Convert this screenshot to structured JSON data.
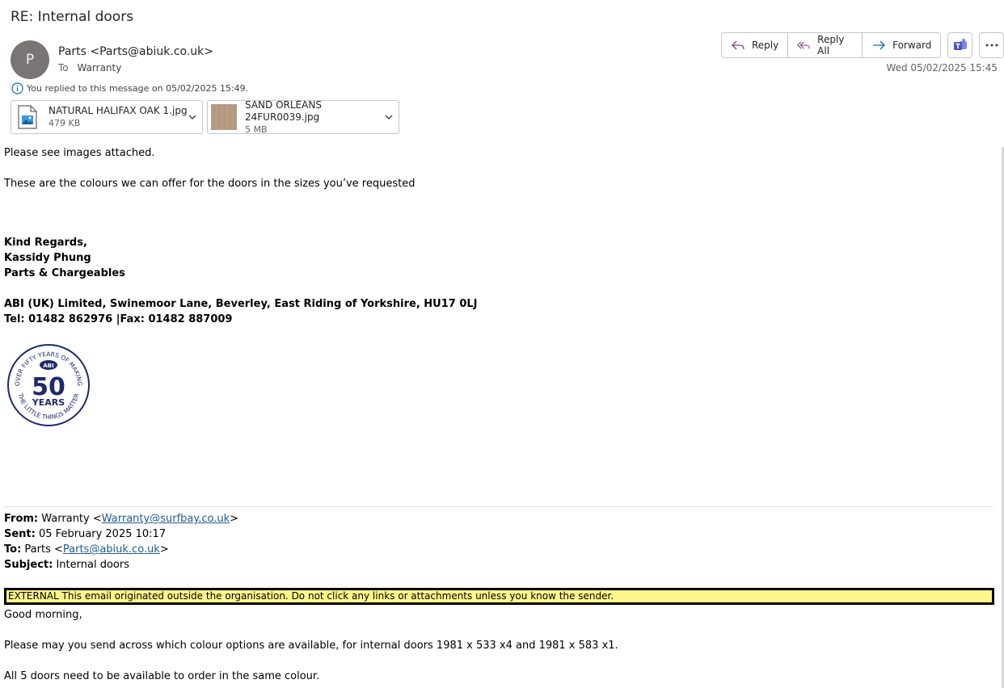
{
  "email": {
    "subject": "RE: Internal doors",
    "avatar_initial": "P",
    "sender": "Parts <Parts@abiuk.co.uk>",
    "to_label": "To",
    "to_value": "Warranty",
    "date": "Wed 05/02/2025 15:45",
    "replied_notice": "You replied to this message on 05/02/2025 15:49."
  },
  "actions": {
    "reply": "Reply",
    "reply_all": "Reply All",
    "forward": "Forward",
    "teams_icon": "teams-icon",
    "more_icon": "more-icon"
  },
  "attachments": [
    {
      "name": "NATURAL HALIFAX OAK 1.jpg",
      "size": "479 KB",
      "icon": "image-file-icon"
    },
    {
      "name": "SAND ORLEANS 24FUR0039.jpg",
      "size": "5 MB",
      "icon": "wood-thumbnail"
    }
  ],
  "body": {
    "line1": "Please see images attached.",
    "line2": "These are the colours we can offer for the doors in the sizes you’ve requested",
    "regards": "Kind Regards,",
    "name": "Kassidy Phung",
    "dept": "Parts & Chargeables",
    "address": "ABI (UK) Limited, Swinemoor Lane, Beverley, East Riding of Yorkshire, HU17 0LJ",
    "phone": "Tel: 01482 862976 |Fax: 01482 887009",
    "logo": {
      "ring_text": "OVER FIFTY YEARS OF MAKING THE LITTLE THINGS MATTER",
      "brand": "ABI",
      "number": "50",
      "word": "YEARS"
    }
  },
  "quoted": {
    "from_label": "From:",
    "from_name": "Warranty <",
    "from_email": "Warranty@surfbay.co.uk",
    "from_close": ">",
    "sent_label": "Sent:",
    "sent_value": "05 February 2025 10:17",
    "to_label": "To:",
    "to_name": "Parts <",
    "to_email": "Parts@abiuk.co.uk",
    "to_close": ">",
    "subject_label": "Subject:",
    "subject_value": "Internal doors",
    "external_banner": "EXTERNAL This email originated outside the organisation. Do not click any links or attachments unless you know the sender.",
    "greeting": "Good morning,",
    "request": "Please may you send across which colour options are available, for internal doors 1981 x 533 x4 and 1981 x 583 x1.",
    "requirement": "All 5 doors need to be available to order in the same colour."
  },
  "colors": {
    "avatar_bg": "#7a7574",
    "link": "#1f5b8f",
    "banner_bg": "#fff68a",
    "logo_navy": "#1d2a6b",
    "wood": "#b79d84"
  }
}
